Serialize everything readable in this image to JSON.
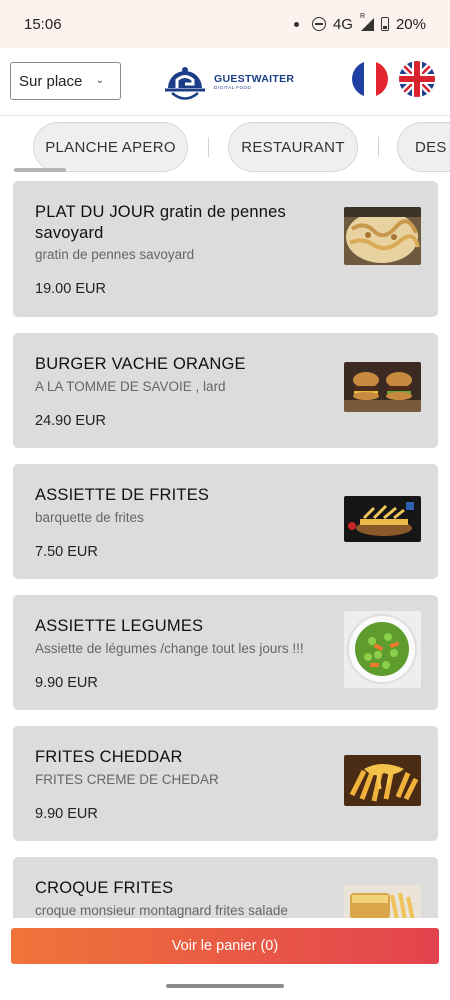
{
  "status": {
    "time": "15:06",
    "network": "4G",
    "roaming": "R",
    "battery": "20%"
  },
  "header": {
    "mode_select": {
      "value": "Sur place"
    },
    "logo": {
      "name": "GUESTWAITER",
      "tagline": "DIGITAL FOOD"
    },
    "flags": [
      {
        "lang": "fr",
        "icon": "flag-france-icon"
      },
      {
        "lang": "en",
        "icon": "flag-uk-icon"
      }
    ]
  },
  "categories": {
    "items": [
      {
        "label": "PLANCHE APERO"
      },
      {
        "label": "RESTAURANT"
      },
      {
        "label": "DES"
      }
    ],
    "active_index": 0
  },
  "menu": {
    "items": [
      {
        "name": "PLAT DU JOUR gratin de pennes savoyard",
        "description": "gratin de pennes savoyard",
        "price": "19.00 EUR",
        "photo": "gratin-photo"
      },
      {
        "name": "BURGER VACHE ORANGE",
        "description": "A LA TOMME DE SAVOIE , lard",
        "price": "24.90 EUR",
        "photo": "burger-photo"
      },
      {
        "name": "ASSIETTE DE FRITES",
        "description": "barquette de frites",
        "price": "7.50 EUR",
        "photo": "fries-photo"
      },
      {
        "name": "ASSIETTE LEGUMES",
        "description": "Assiette de légumes /change tout les jours !!!",
        "price": "9.90 EUR",
        "photo": "vegetables-photo"
      },
      {
        "name": "FRITES CHEDDAR",
        "description": "FRITES CREME DE CHEDAR",
        "price": "9.90 EUR",
        "photo": "cheddar-fries-photo"
      },
      {
        "name": "CROQUE FRITES",
        "description": "croque monsieur montagnard frites salade",
        "price": "",
        "photo": "croque-photo"
      }
    ]
  },
  "cart": {
    "label": "Voir le panier (0)",
    "gradient_start": "#f0743a",
    "gradient_end": "#e2434e"
  },
  "colors": {
    "card_bg": "#dcdcdc",
    "brand": "#1c3e86",
    "status_bar_bg": "#fdf3ee"
  }
}
